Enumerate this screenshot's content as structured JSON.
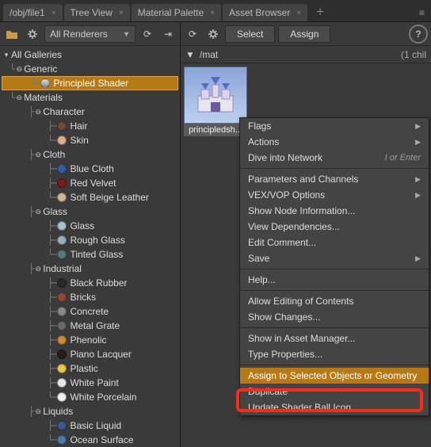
{
  "tabs": [
    {
      "label": "/obj/file1"
    },
    {
      "label": "Tree View"
    },
    {
      "label": "Material Palette"
    },
    {
      "label": "Asset Browser"
    }
  ],
  "leftToolbar": {
    "dropdown": "All Renderers"
  },
  "tree": {
    "root": "All Galleries",
    "generic": "Generic",
    "principled": "Principled Shader",
    "materials": "Materials",
    "character": {
      "label": "Character",
      "items": [
        "Hair",
        "Skin"
      ],
      "colors": [
        "#6a4a3a",
        "#d8b090"
      ]
    },
    "cloth": {
      "label": "Cloth",
      "items": [
        "Blue Cloth",
        "Red Velvet",
        "Soft Beige Leather"
      ],
      "colors": [
        "#3a5aa0",
        "#7a1a1a",
        "#c8b898"
      ]
    },
    "glass": {
      "label": "Glass",
      "items": [
        "Glass",
        "Rough Glass",
        "Tinted Glass"
      ],
      "colors": [
        "#a8c0c8",
        "#98b0b8",
        "#5a7a7a"
      ]
    },
    "industrial": {
      "label": "Industrial",
      "items": [
        "Black Rubber",
        "Bricks",
        "Concrete",
        "Metal Grate",
        "Phenolic",
        "Piano Lacquer",
        "Plastic",
        "White Paint",
        "White Porcelain"
      ],
      "colors": [
        "#2a2a2a",
        "#8a4a3a",
        "#888",
        "#6a6a6a",
        "#c88a3a",
        "#2a1a1a",
        "#e8c84a",
        "#e8e8e8",
        "#f0f0f0"
      ]
    },
    "liquids": {
      "label": "Liquids",
      "items": [
        "Basic Liquid",
        "Ocean Surface"
      ],
      "colors": [
        "#3a5a8a",
        "#4a7aa8"
      ]
    }
  },
  "rightToolbar": {
    "select": "Select",
    "assign": "Assign"
  },
  "crumb": {
    "path": "/mat",
    "info": "(1 chil"
  },
  "thumb": {
    "label": "principledsh..."
  },
  "menu": {
    "flags": "Flags",
    "actions": "Actions",
    "dive": "Dive into Network",
    "dive_hint": "I or Enter",
    "params": "Parameters and Channels",
    "vex": "VEX/VOP Options",
    "shownode": "Show Node Information...",
    "viewdep": "View Dependencies...",
    "editc": "Edit Comment...",
    "save": "Save",
    "help": "Help...",
    "allowedit": "Allow Editing of Contents",
    "showchg": "Show Changes...",
    "showasset": "Show in Asset Manager...",
    "typeprop": "Type Properties...",
    "assign": "Assign to Selected Objects or Geometry",
    "duplicate": "Duplicate",
    "updball": "Update Shader Ball Icon"
  }
}
